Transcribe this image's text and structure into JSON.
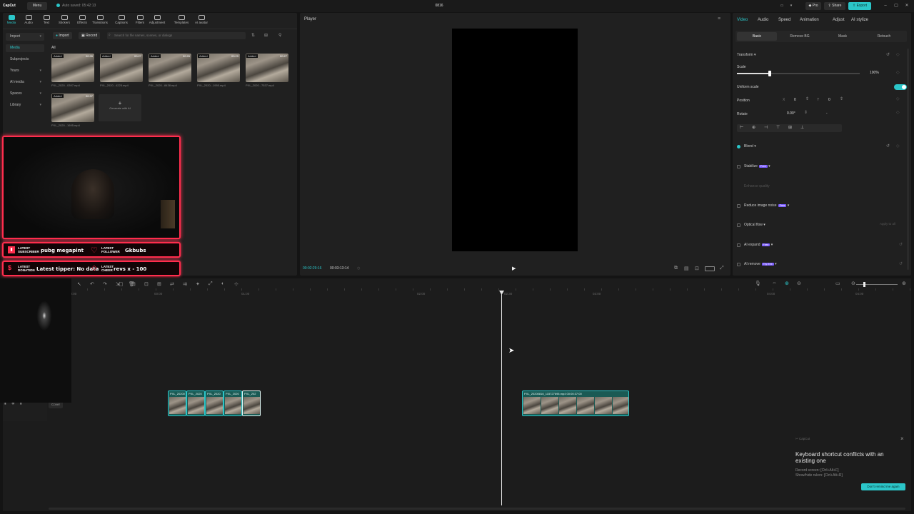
{
  "titlebar": {
    "logo": "CapCut",
    "menu": "Menu",
    "autosave": "Auto saved: 05:42:13",
    "project_title": "0816",
    "pro": "Pro",
    "share": "Share",
    "export": "Export"
  },
  "toolbar": [
    {
      "label": "Media",
      "active": true
    },
    {
      "label": "Audio"
    },
    {
      "label": "Text"
    },
    {
      "label": "Stickers"
    },
    {
      "label": "Effects"
    },
    {
      "label": "Transitions"
    },
    {
      "label": "Captions"
    },
    {
      "label": "Filters"
    },
    {
      "label": "Adjustment"
    },
    {
      "label": "Templates"
    },
    {
      "label": "AI avatar"
    }
  ],
  "media": {
    "sidebar": [
      {
        "label": "Import",
        "chev": "▾"
      },
      {
        "label": "Media",
        "selected": true
      },
      {
        "label": "Subprojects"
      },
      {
        "label": "Yours",
        "chev": "▾"
      },
      {
        "label": "AI media",
        "chev": "▾"
      },
      {
        "label": "Spaces",
        "chev": "▾"
      },
      {
        "label": "Library",
        "chev": "▾"
      }
    ],
    "import_btn": "Import",
    "record_btn": "Record",
    "search_placeholder": "Search for file names, scenes, or dialogs",
    "filter_all": "All",
    "thumbs": [
      {
        "added": "Added",
        "dur": "00:26",
        "name": "PXL_2020...0397.mp4"
      },
      {
        "added": "Added",
        "dur": "00:27",
        "name": "PXL_2020...4225.mp4"
      },
      {
        "added": "Added",
        "dur": "00:26",
        "name": "PXL_2020...8438.mp4"
      },
      {
        "added": "Added",
        "dur": "00:29",
        "name": "PXL_2020...1950.mp4"
      },
      {
        "added": "Added",
        "dur": "00:27",
        "name": "PXL_2020...7537.mp4"
      },
      {
        "added": "Added",
        "dur": "00:37",
        "name": "PXL_2020...1695.mp4"
      }
    ],
    "generate": {
      "plus": "+",
      "label": "Generate with AI"
    }
  },
  "overlay": {
    "sub_label": "LATEST\nSUBSCRIBER",
    "sub_value": "pubg megapint",
    "follow_label": "LATEST\nFOLLOWER",
    "follow_value": "Gkbubs",
    "donation_label": "LATEST\nDONATION",
    "donation_value": "Latest tipper: No data",
    "cheer_label": "LATEST\nCHEER",
    "cheer_value": "revs x - 100"
  },
  "player": {
    "title": "Player",
    "current_time": "00:02:29:16",
    "total_time": "00:03:13:14",
    "play_icon": "▶"
  },
  "inspector": {
    "tabs": [
      "Video",
      "Audio",
      "Speed",
      "Animation",
      "Adjust",
      "AI stylize"
    ],
    "subtabs": [
      "Basic",
      "Remove BG",
      "Mask",
      "Retouch"
    ],
    "transform": "Transform",
    "scale": "Scale",
    "scale_value": "100%",
    "scale_level": 0.27,
    "uniform_scale": "Uniform scale",
    "position": "Position",
    "pos_x_label": "X",
    "pos_x": "0",
    "pos_y_label": "Y",
    "pos_y": "0",
    "rotate": "Rotate",
    "rotate_value": "0.00°",
    "rotate_dash": "-",
    "blend": "Blend",
    "stabilize": "Stabilize",
    "stabilize_badge": "Free",
    "enhance": "Enhance quality",
    "reduce_noise": "Reduce image noise",
    "reduce_badge": "Free",
    "optical_flow": "Optical flow",
    "ai_expand": "AI expand",
    "ai_expand_badge": "Free",
    "ai_remove": "AI remove",
    "ai_remove_badge": "Try free",
    "apply_all": "Apply to all"
  },
  "timeline": {
    "ruler": [
      "00:00",
      "00:00",
      "01:00",
      "02:00",
      "02:30",
      "03:00",
      "04:00",
      "04:00"
    ],
    "cover_label": "Cover",
    "clips_left": [
      "PXL_20200",
      "PXL_2020",
      "PXL_2020",
      "PXL_2020",
      "PXL_202"
    ],
    "clip_right": "PXL_20200816_115727695.mp4  00:00:37:00"
  },
  "toast": {
    "app": "CapCut",
    "close": "×",
    "title": "Keyboard shortcut conflicts with an existing one",
    "line1": "Record screen: [Ctrl+Alt+F]",
    "line2": "Show/hide rulers: [Ctrl+Alt+R]",
    "button": "Don't remind me again"
  },
  "colors": {
    "accent": "#2bc6c9",
    "overlay_red": "#ff2d4d",
    "badge": "#7b5cff"
  }
}
